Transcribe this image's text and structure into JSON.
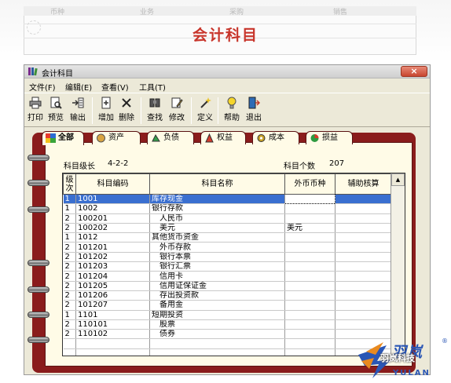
{
  "page": {
    "title": "会计科目",
    "background_labels": [
      "币种",
      "业务",
      "采购",
      "销售"
    ]
  },
  "window": {
    "title": "会计科目",
    "close_label": "×"
  },
  "menu": [
    "文件(F)",
    "编辑(E)",
    "查看(V)",
    "工具(T)"
  ],
  "toolbar": [
    "打印",
    "预览",
    "输出",
    "增加",
    "删除",
    "查找",
    "修改",
    "定义",
    "帮助",
    "退出"
  ],
  "tabs": [
    "全部",
    "资产",
    "负债",
    "权益",
    "成本",
    "损益"
  ],
  "info": {
    "level_label": "科目级长",
    "level_value": "4-2-2",
    "count_label": "科目个数",
    "count_value": "207"
  },
  "table": {
    "headers": [
      "级次",
      "科目编码",
      "科目名称",
      "外币币种",
      "辅助核算"
    ],
    "rows": [
      [
        "1",
        "1001",
        "库存现金",
        "",
        ""
      ],
      [
        "1",
        "1002",
        "银行存款",
        "",
        ""
      ],
      [
        "2",
        "100201",
        "人民币",
        "",
        ""
      ],
      [
        "2",
        "100202",
        "美元",
        "美元",
        ""
      ],
      [
        "1",
        "1012",
        "其他货币资金",
        "",
        ""
      ],
      [
        "2",
        "101201",
        "外币存款",
        "",
        ""
      ],
      [
        "2",
        "101202",
        "银行本票",
        "",
        ""
      ],
      [
        "2",
        "101203",
        "银行汇票",
        "",
        ""
      ],
      [
        "2",
        "101204",
        "信用卡",
        "",
        ""
      ],
      [
        "2",
        "101205",
        "信用证保证金",
        "",
        ""
      ],
      [
        "2",
        "101206",
        "存出投资款",
        "",
        ""
      ],
      [
        "2",
        "101207",
        "备用金",
        "",
        ""
      ],
      [
        "1",
        "1101",
        "短期投资",
        "",
        ""
      ],
      [
        "2",
        "110101",
        "股票",
        "",
        ""
      ],
      [
        "2",
        "110102",
        "债券",
        "",
        ""
      ]
    ]
  },
  "watermark": {
    "brand": "羽岚",
    "sub": "羽岚科技",
    "latin": "YULAN",
    "reg": "®"
  },
  "colors": {
    "title_red": "#c8352b",
    "selection_blue": "#3a6fd0",
    "notebook_red": "#8a1c1c",
    "brand_blue": "#2a56b5"
  }
}
